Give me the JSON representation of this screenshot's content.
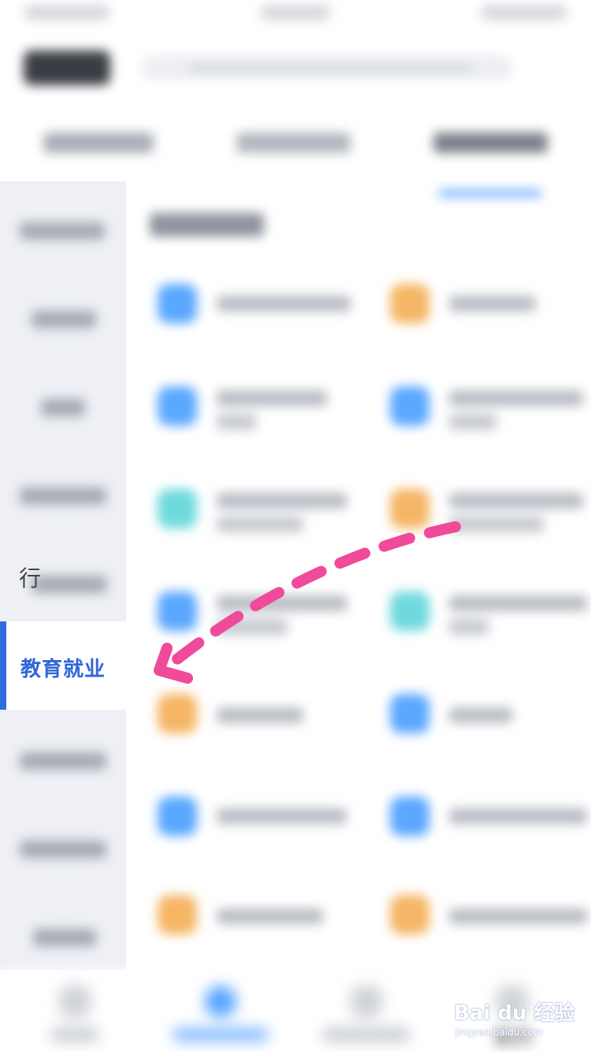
{
  "sidebar": {
    "active_item_label": "教育就业",
    "partial_item_prefix": "行"
  },
  "bottom_nav": {
    "me_label": "我的"
  },
  "watermark": {
    "brand": "Bai du 经验",
    "url": "jingyan.baidu.com"
  },
  "colors": {
    "accent_blue": "#2f66d7",
    "sidebar_bg": "#eef0f5",
    "annotation_pink": "#f04a9a",
    "icon_blue": "#5aa7ff",
    "icon_orange": "#f5b564",
    "icon_cyan": "#6fd9dd"
  },
  "icons": [
    "blue-square-icon",
    "orange-square-icon",
    "cyan-square-icon",
    "annotation-arrow-icon"
  ]
}
